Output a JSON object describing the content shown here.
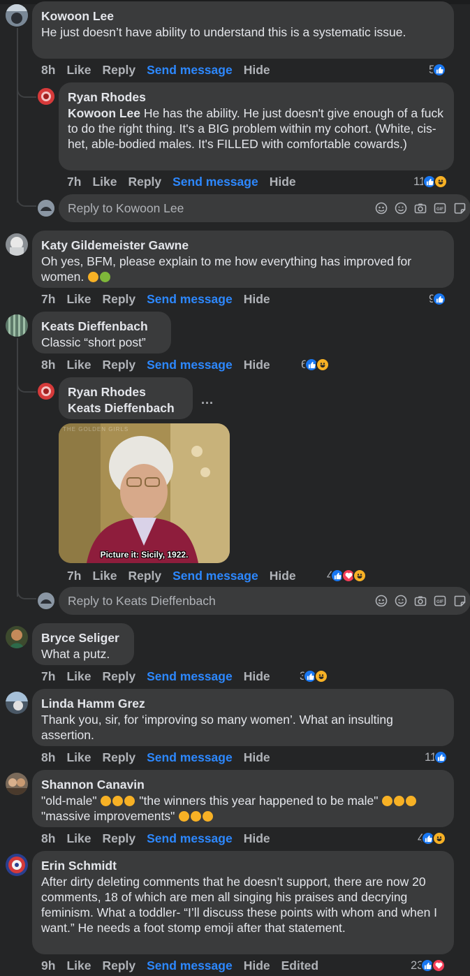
{
  "comments": [
    {
      "author": "Kowoon Lee",
      "text": "He just doesn’t have ability to understand this is a systematic issue.",
      "time": "8h",
      "like": "Like",
      "reply": "Reply",
      "send": "Send message",
      "hide": "Hide",
      "reaction_count": "5",
      "reactions": [
        "like"
      ]
    },
    {
      "author": "Ryan Rhodes",
      "tagged": "Kowoon Lee",
      "text": " He has the ability. He just doesn't give enough of a fuck to do the right thing. It's a BIG problem within my cohort. (White, cis-het, able-bodied males. It's FILLED with comfortable cowards.)",
      "time": "7h",
      "like": "Like",
      "reply": "Reply",
      "send": "Send message",
      "hide": "Hide",
      "reaction_count": "11",
      "reactions": [
        "like",
        "haha"
      ]
    },
    {
      "author": "Katy Gildemeister Gawne",
      "text": "Oh yes, BFM, please explain to me how everything has improved for women.",
      "time": "7h",
      "like": "Like",
      "reply": "Reply",
      "send": "Send message",
      "hide": "Hide",
      "reaction_count": "9",
      "reactions": [
        "like"
      ]
    },
    {
      "author": "Keats Dieffenbach",
      "text": "Classic “short post”",
      "time": "8h",
      "like": "Like",
      "reply": "Reply",
      "send": "Send message",
      "hide": "Hide",
      "reaction_count": "6",
      "reactions": [
        "like",
        "haha"
      ]
    },
    {
      "author": "Ryan Rhodes",
      "tagged": "Keats Dieffenbach",
      "more": "...",
      "gif_caption": "Picture it: Sicily, 1922.",
      "gif_watermark": "THE GOLDEN GIRLS",
      "time": "7h",
      "like": "Like",
      "reply": "Reply",
      "send": "Send message",
      "hide": "Hide",
      "reaction_count": "4",
      "reactions": [
        "like",
        "love",
        "haha"
      ]
    },
    {
      "author": "Bryce Seliger",
      "text": "What a putz.",
      "time": "7h",
      "like": "Like",
      "reply": "Reply",
      "send": "Send message",
      "hide": "Hide",
      "reaction_count": "3",
      "reactions": [
        "like",
        "haha"
      ]
    },
    {
      "author": "Linda Hamm Grez",
      "text": "Thank you, sir, for ‘improving so many women’. What an insulting assertion.",
      "time": "8h",
      "like": "Like",
      "reply": "Reply",
      "send": "Send message",
      "hide": "Hide",
      "reaction_count": "11",
      "reactions": [
        "like"
      ]
    },
    {
      "author": "Shannon Canavin",
      "text_parts": [
        "\"old-male\" ",
        " \"the winners this year happened to be male\" ",
        " \"massive improvements\" "
      ],
      "time": "8h",
      "like": "Like",
      "reply": "Reply",
      "send": "Send message",
      "hide": "Hide",
      "reaction_count": "4",
      "reactions": [
        "like",
        "haha"
      ]
    },
    {
      "author": "Erin Schmidt",
      "text": "After dirty deleting comments that he doesn’t support, there are now 20 comments, 18 of which are men all singing his praises and decrying feminism. What a toddler- “I’ll discuss these points with whom and when I want.” He needs a foot stomp emoji after that statement.",
      "time": "9h",
      "like": "Like",
      "reply": "Reply",
      "send": "Send message",
      "hide": "Hide",
      "edited": "Edited",
      "reaction_count": "23",
      "reactions": [
        "like",
        "love"
      ]
    }
  ],
  "reply_boxes": [
    {
      "placeholder": "Reply to Kowoon Lee"
    },
    {
      "placeholder": "Reply to Keats Dieffenbach"
    }
  ],
  "colors": {
    "background": "#242526",
    "bubble": "#3a3b3c",
    "link": "#2d88ff",
    "like": "#1877f2",
    "haha": "#f7b125",
    "love": "#f33e58"
  }
}
